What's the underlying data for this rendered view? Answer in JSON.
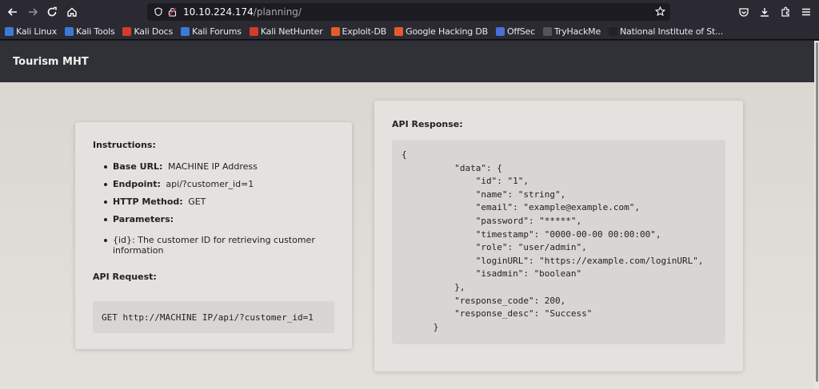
{
  "browser": {
    "url_host": "10.10.224.174",
    "url_path": "/planning/",
    "bookmarks": [
      {
        "label": "Kali Linux",
        "color": "#3a7bd5"
      },
      {
        "label": "Kali Tools",
        "color": "#3a7bd5"
      },
      {
        "label": "Kali Docs",
        "color": "#d43b2a"
      },
      {
        "label": "Kali Forums",
        "color": "#3a7bd5"
      },
      {
        "label": "Kali NetHunter",
        "color": "#d43b2a"
      },
      {
        "label": "Exploit-DB",
        "color": "#e25c2b"
      },
      {
        "label": "Google Hacking DB",
        "color": "#e25c2b"
      },
      {
        "label": "OffSec",
        "color": "#4a6fd6"
      },
      {
        "label": "TryHackMe",
        "color": "#555555"
      },
      {
        "label": "National Institute of St...",
        "color": "#222222"
      }
    ]
  },
  "site": {
    "title": "Tourism MHT"
  },
  "instructions": {
    "heading": "Instructions:",
    "items": [
      {
        "label": "Base URL:",
        "value": "MACHINE IP Address"
      },
      {
        "label": "Endpoint:",
        "value": "api/?customer_id=1"
      },
      {
        "label": "HTTP Method:",
        "value": "GET"
      },
      {
        "label": "Parameters:",
        "value": ""
      }
    ],
    "param": "{id}: The customer ID for retrieving customer information",
    "request_heading": "API Request:",
    "request": "GET http://MACHINE IP/api/?customer_id=1"
  },
  "response": {
    "heading": "API Response:",
    "body": "{\n          \"data\": {\n              \"id\": \"1\",\n              \"name\": \"string\",\n              \"email\": \"example@example.com\",\n              \"password\": \"*****\",\n              \"timestamp\": \"0000-00-00 00:00:00\",\n              \"role\": \"user/admin\",\n              \"loginURL\": \"https://example.com/loginURL\",\n              \"isadmin\": \"boolean\"\n          },\n          \"response_code\": 200,\n          \"response_desc\": \"Success\"\n      }"
  }
}
